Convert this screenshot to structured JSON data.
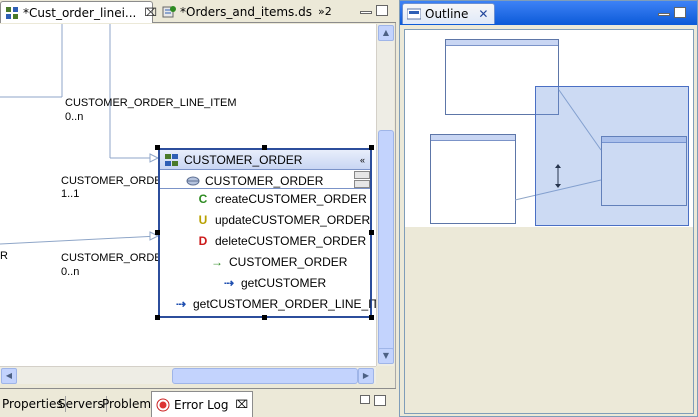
{
  "editor": {
    "tabs": [
      {
        "label": "*Cust_order_linei...",
        "active": true
      },
      {
        "label": "*Orders_and_items.ds",
        "active": false
      }
    ],
    "overflow_label": "»2",
    "close_glyph": "⌧"
  },
  "diagram": {
    "labels": {
      "line_item_assoc": "CUSTOMER_ORDER_LINE_ITEM",
      "line_item_mult": "0..n",
      "order_assoc": "CUSTOMER_ORDER",
      "order_mult": "1..1",
      "order_assoc2": "CUSTOMER_ORDER",
      "order_mult2": "0..n",
      "r_label": "R"
    },
    "class_box": {
      "title": "CUSTOMER_ORDER",
      "collapse_glyph": "«",
      "members": [
        {
          "icon": "key-attribute-icon",
          "glyph": "⊖",
          "label": "CUSTOMER_ORDER"
        },
        {
          "icon": "create-icon",
          "glyph": "C",
          "label": "createCUSTOMER_ORDER",
          "color": "#2e8b22"
        },
        {
          "icon": "update-icon",
          "glyph": "U",
          "label": "updateCUSTOMER_ORDER",
          "color": "#b8a000"
        },
        {
          "icon": "delete-icon",
          "glyph": "D",
          "label": "deleteCUSTOMER_ORDER",
          "color": "#cc1a1a"
        },
        {
          "icon": "read-icon",
          "glyph": "→",
          "label": "CUSTOMER_ORDER",
          "color": "#2e8b22"
        },
        {
          "icon": "get-icon",
          "glyph": "⇢",
          "label": "getCUSTOMER",
          "color": "#1f4fb0"
        },
        {
          "icon": "get-list-icon",
          "glyph": "⇢",
          "label": "getCUSTOMER_ORDER_LINE_ITEM",
          "color": "#1f4fb0"
        }
      ]
    }
  },
  "bottom_tabs": [
    {
      "label": "Properties"
    },
    {
      "label": "Servers"
    },
    {
      "label": "Problems"
    },
    {
      "label": "Error Log",
      "active": true
    }
  ],
  "bottom_close_glyph": "⌧",
  "outline": {
    "tab_label": "Outline",
    "close_glyph": "✕"
  },
  "colors": {
    "accent": "#0c5ad8",
    "class_border": "#2c4e9c",
    "selection": "#4a6fc4"
  }
}
